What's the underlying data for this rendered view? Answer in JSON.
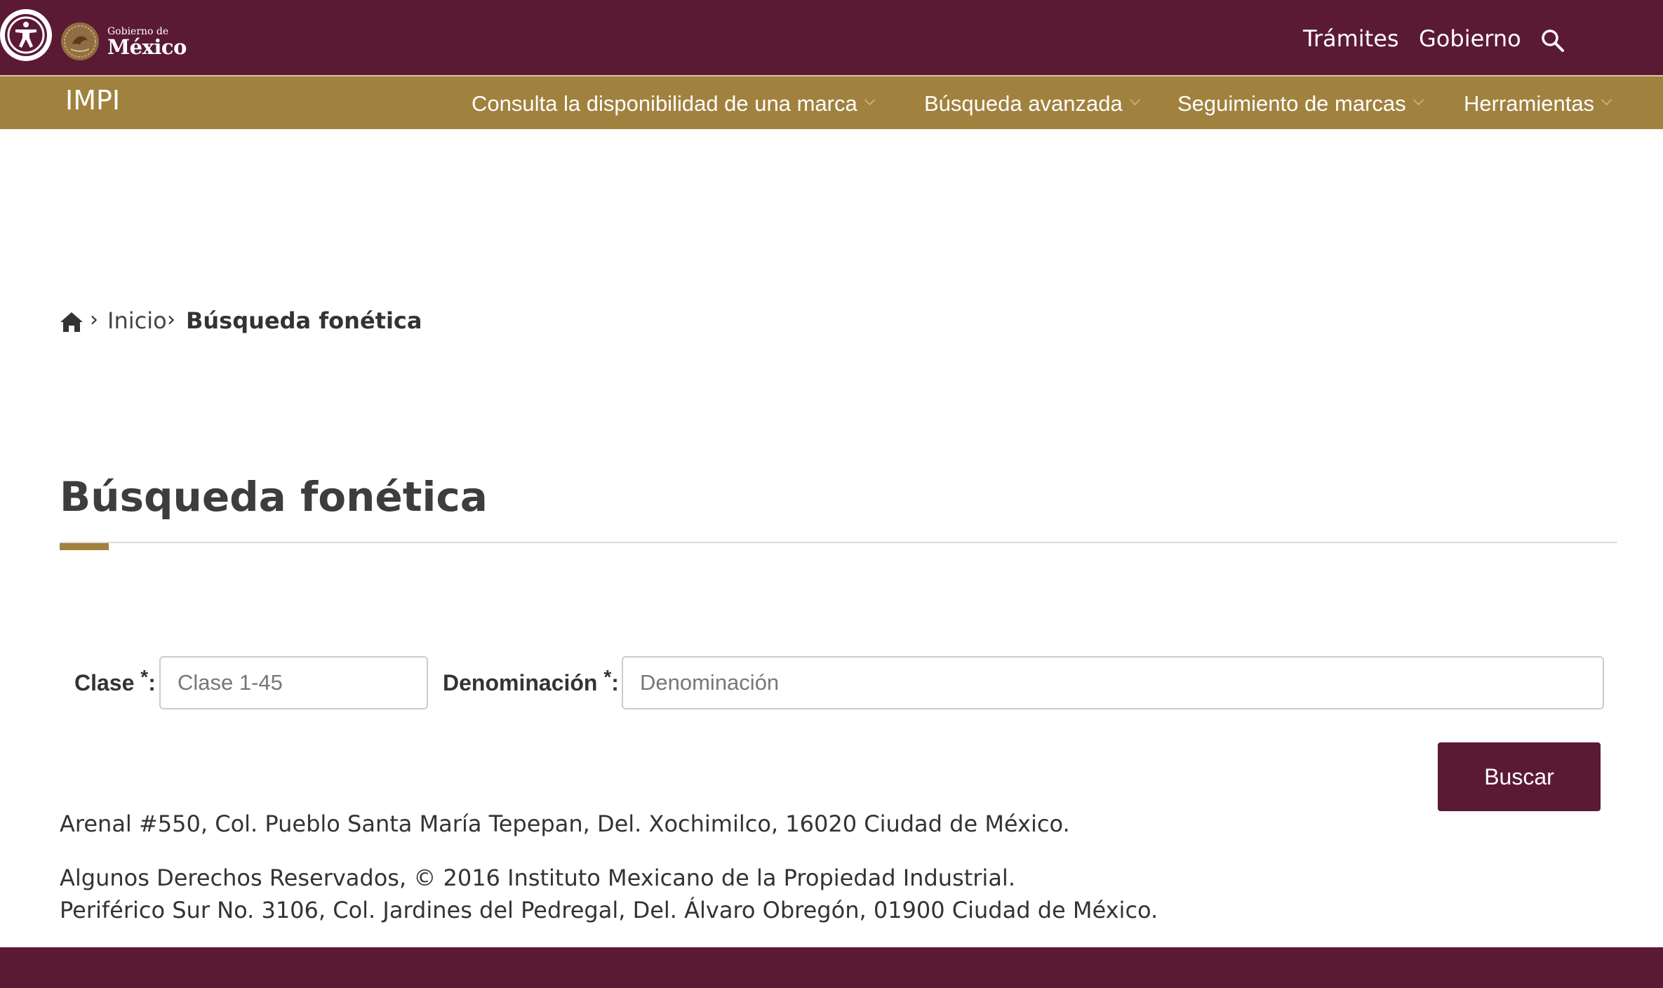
{
  "header": {
    "accessibility_label": "Accesibilidad",
    "logo_small": "Gobierno de",
    "logo_big": "México",
    "links": [
      "Trámites",
      "Gobierno"
    ]
  },
  "nav": {
    "brand": "IMPI",
    "items": [
      "Consulta la disponibilidad de una marca",
      "Búsqueda avanzada",
      "Seguimiento de marcas",
      "Herramientas"
    ]
  },
  "breadcrumb": {
    "home": "Inicio",
    "current": "Búsqueda fonética"
  },
  "page": {
    "title": "Búsqueda fonética"
  },
  "form": {
    "clase_label": "Clase",
    "clase_placeholder": "Clase 1-45",
    "denominacion_label": "Denominación",
    "denominacion_placeholder": "Denominación",
    "required_mark": "*",
    "label_suffix": ":",
    "submit_label": "Buscar"
  },
  "footer": {
    "address": "Arenal #550, Col. Pueblo Santa María Tepepan, Del. Xochimilco, 16020 Ciudad de México.",
    "rights": "Algunos Derechos Reservados, © 2016 Instituto Mexicano de la Propiedad Industrial.",
    "address2": "Periférico Sur No. 3106, Col. Jardines del Pedregal, Del. Álvaro Obregón, 01900 Ciudad de México."
  },
  "colors": {
    "primary": "#5b1a33",
    "gold": "#a0813e"
  }
}
